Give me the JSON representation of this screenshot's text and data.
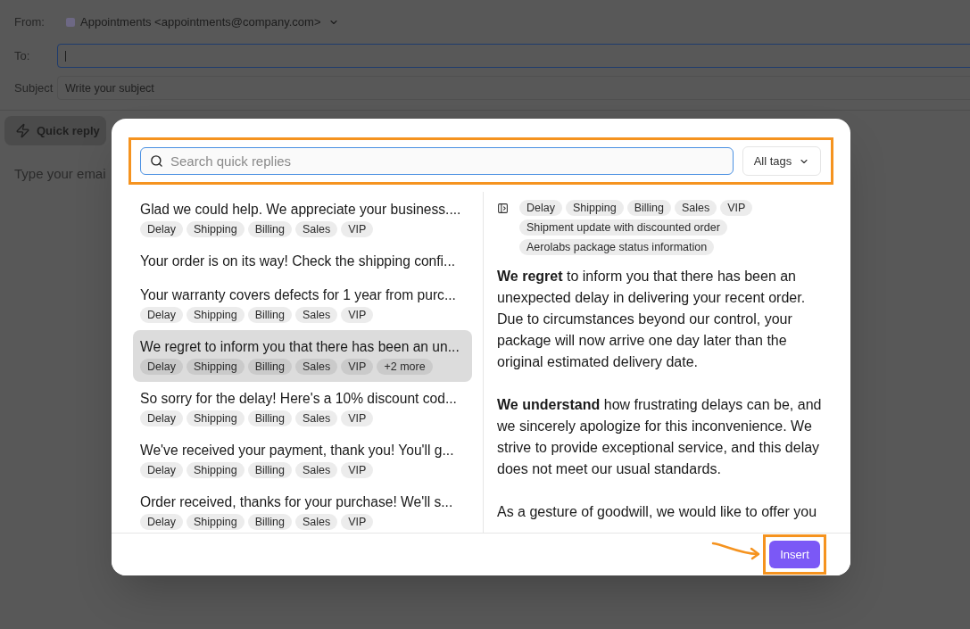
{
  "compose": {
    "from": {
      "label": "From:",
      "value": "Appointments <appointments@company.com>"
    },
    "to": {
      "label": "To:",
      "focused": true
    },
    "subject": {
      "label": "Subject",
      "placeholder": "Write your subject"
    },
    "quick_reply_button": "Quick reply",
    "body_placeholder": "Type your emai"
  },
  "quick_reply_dialog": {
    "search_bar": {
      "highlighted": true,
      "search": {
        "placeholder": "Search quick replies",
        "focused": true
      },
      "tag_filter": "All tags"
    },
    "replies": [
      {
        "title": "Glad we could help. We appreciate your business....",
        "tags": [
          "Delay",
          "Shipping",
          "Billing",
          "Sales",
          "VIP"
        ],
        "selected": false
      },
      {
        "title": "Your order is on its way! Check the shipping confi...",
        "selected": false
      },
      {
        "title": "Your warranty covers defects for 1 year from purc...",
        "tags": [
          "Delay",
          "Shipping",
          "Billing",
          "Sales",
          "VIP"
        ],
        "selected": false
      },
      {
        "title": "We regret to inform you that there has been an un...",
        "tags": [
          "Delay",
          "Shipping",
          "Billing",
          "Sales",
          "VIP"
        ],
        "more": "+2 more",
        "selected": true
      },
      {
        "title": "So sorry for the delay! Here's a 10% discount cod...",
        "tags": [
          "Delay",
          "Shipping",
          "Billing",
          "Sales",
          "VIP"
        ],
        "selected": false
      },
      {
        "title": "We've received your payment, thank you! You'll g...",
        "tags": [
          "Delay",
          "Shipping",
          "Billing",
          "Sales",
          "VIP"
        ],
        "selected": false
      },
      {
        "title": "Order received, thanks for your purchase! We'll s...",
        "tags": [
          "Delay",
          "Shipping",
          "Billing",
          "Sales",
          "VIP"
        ],
        "selected": false
      }
    ],
    "preview": {
      "tags": [
        "Delay",
        "Shipping",
        "Billing",
        "Sales",
        "VIP",
        "Shipment update with discounted order",
        "Aerolabs package status information"
      ],
      "paragraphs": [
        "**We regret** to inform you that there has been an unexpected delay in delivering your recent order. Due to circumstances beyond our control, your package will now arrive one day later than the original estimated delivery date.",
        "**We understand** how frustrating delays can be, and we sincerely apologize for this inconvenience. We strive to provide exceptional service, and this delay does not meet our usual standards.",
        "As a gesture of goodwill, we would like to offer you"
      ]
    },
    "insert_button": {
      "label": "Insert",
      "highlighted": true
    }
  }
}
